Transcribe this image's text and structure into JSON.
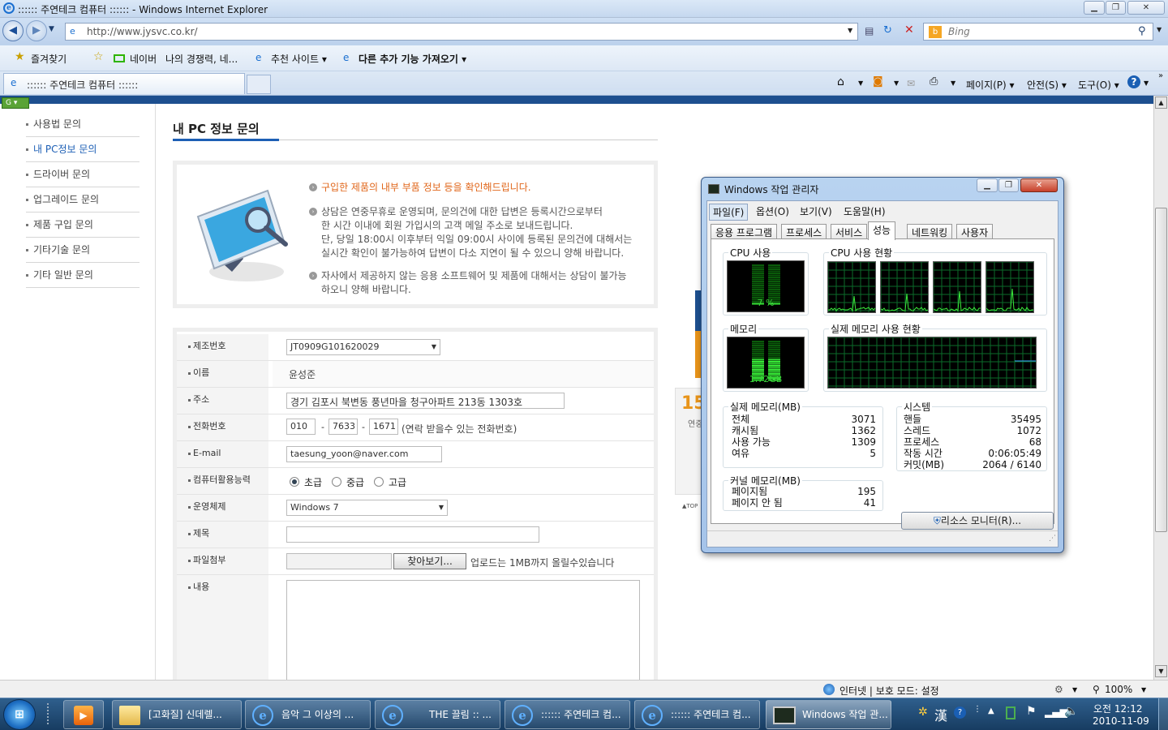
{
  "ie": {
    "window_title": ":::::: 주연테크 컴퓨터 :::::: - Windows Internet Explorer",
    "url": "http://www.jysvc.co.kr/",
    "search_placeholder": "Bing",
    "favorites_label": "즐겨찾기",
    "fav_items": [
      "네이버",
      "나의 경쟁력, 네...",
      "추천 사이트 ▾",
      "다른 추가 기능 가져오기 ▾"
    ],
    "tab_title": ":::::: 주연테크 컴퓨터 ::::::",
    "commands": [
      "페이지(P) ▾",
      "안전(S) ▾",
      "도구(O) ▾"
    ]
  },
  "page": {
    "sidebar": [
      {
        "label": "사용법 문의"
      },
      {
        "label": "내 PC정보 문의"
      },
      {
        "label": "드라이버 문의"
      },
      {
        "label": "업그레이드 문의"
      },
      {
        "label": "제품 구입 문의"
      },
      {
        "label": "기타기술 문의"
      },
      {
        "label": "기타 일반 문의"
      }
    ],
    "title": "내 PC 정보 문의",
    "info": {
      "highlight": "구입한 제품의 내부 부품 정보 등을 확인해드립니다.",
      "para1_lines": [
        "상담은 연중무휴로 운영되며, 문의건에 대한 답변은 등록시간으로부터",
        "한 시간 이내에 회원 가입시의 고객 메일 주소로 보내드립니다.",
        "단, 당일 18:00시 이후부터 익일 09:00시 사이에 등록된 문의건에 대해서는",
        "실시간 확인이 불가능하여 답변이 다소 지연이 될 수 있으니 양해 바랍니다."
      ],
      "para2_lines": [
        "자사에서 제공하지 않는 응용 소프트웨어 및 제품에 대해서는 상담이 불가능",
        "하오니 양해 바랍니다."
      ]
    },
    "form": {
      "labels": [
        "제조번호",
        "이름",
        "주소",
        "전화번호",
        "E-mail",
        "컴퓨터활용능력",
        "운영체제",
        "제목",
        "파일첨부",
        "내용"
      ],
      "serial": "JT0909G101620029",
      "name": "윤성준",
      "address": "경기 김포시 북변동 풍년마을 청구아파트 213동 1303호",
      "phone1": "010",
      "phone2": "7633",
      "phone3": "1671",
      "phone_sep": "-",
      "phone_hint": "(연락 받을수 있는 전화번호)",
      "email": "taesung_yoon@naver.com",
      "skill_options": [
        "초급",
        "중급",
        "고급"
      ],
      "skill_selected": "초급",
      "os": "Windows 7",
      "browse_label": "찾아보기...",
      "upload_hint": "업로드는 1MB까지 올릴수있습니다"
    },
    "side_number": "15",
    "side_text": "연중",
    "top_link": "▲TOP"
  },
  "status_bar": {
    "zone": "인터넷 | 보호 모드: 설정",
    "zoom": "100%"
  },
  "task_manager": {
    "title": "Windows 작업 관리자",
    "menu": [
      "파일(F)",
      "옵션(O)",
      "보기(V)",
      "도움말(H)"
    ],
    "tabs": [
      "응용 프로그램",
      "프로세스",
      "서비스",
      "성능",
      "네트워킹",
      "사용자"
    ],
    "active_tab": "성능",
    "cpu_usage_label": "CPU 사용",
    "cpu_usage_value": "7 %",
    "cpu_usage_fraction": 0.07,
    "cpu_history_label": "CPU 사용 현황",
    "memory_label": "메모리",
    "memory_value": "1.72GB",
    "memory_fraction": 0.56,
    "mem_history_label": "실제 메모리 사용 현황",
    "physical_memory": {
      "label": "실제 메모리(MB)",
      "rows": [
        {
          "k": "전체",
          "v": "3071"
        },
        {
          "k": "캐시됨",
          "v": "1362"
        },
        {
          "k": "사용 가능",
          "v": "1309"
        },
        {
          "k": "여유",
          "v": "5"
        }
      ]
    },
    "system": {
      "label": "시스템",
      "rows": [
        {
          "k": "핸들",
          "v": "35495"
        },
        {
          "k": "스레드",
          "v": "1072"
        },
        {
          "k": "프로세스",
          "v": "68"
        },
        {
          "k": "작동 시간",
          "v": "0:06:05:49"
        },
        {
          "k": "커밋(MB)",
          "v": "2064 / 6140"
        }
      ]
    },
    "kernel_memory": {
      "label": "커널 메모리(MB)",
      "rows": [
        {
          "k": "페이지됨",
          "v": "195"
        },
        {
          "k": "페이지 안 됨",
          "v": "41"
        }
      ]
    },
    "resource_monitor_button": "리소스 모니터(R)..."
  },
  "taskbar": {
    "buttons": [
      {
        "label": "[고화질] 신데렐..."
      },
      {
        "label": "음악 그 이상의 ..."
      },
      {
        "label": "THE 끌림 :: ..."
      },
      {
        "label": ":::::: 주연테크 컴..."
      },
      {
        "label": ":::::: 주연테크 컴..."
      },
      {
        "label": "Windows 작업 관..."
      }
    ],
    "ime": "漢",
    "time": "오전 12:12",
    "date": "2010-11-09"
  }
}
